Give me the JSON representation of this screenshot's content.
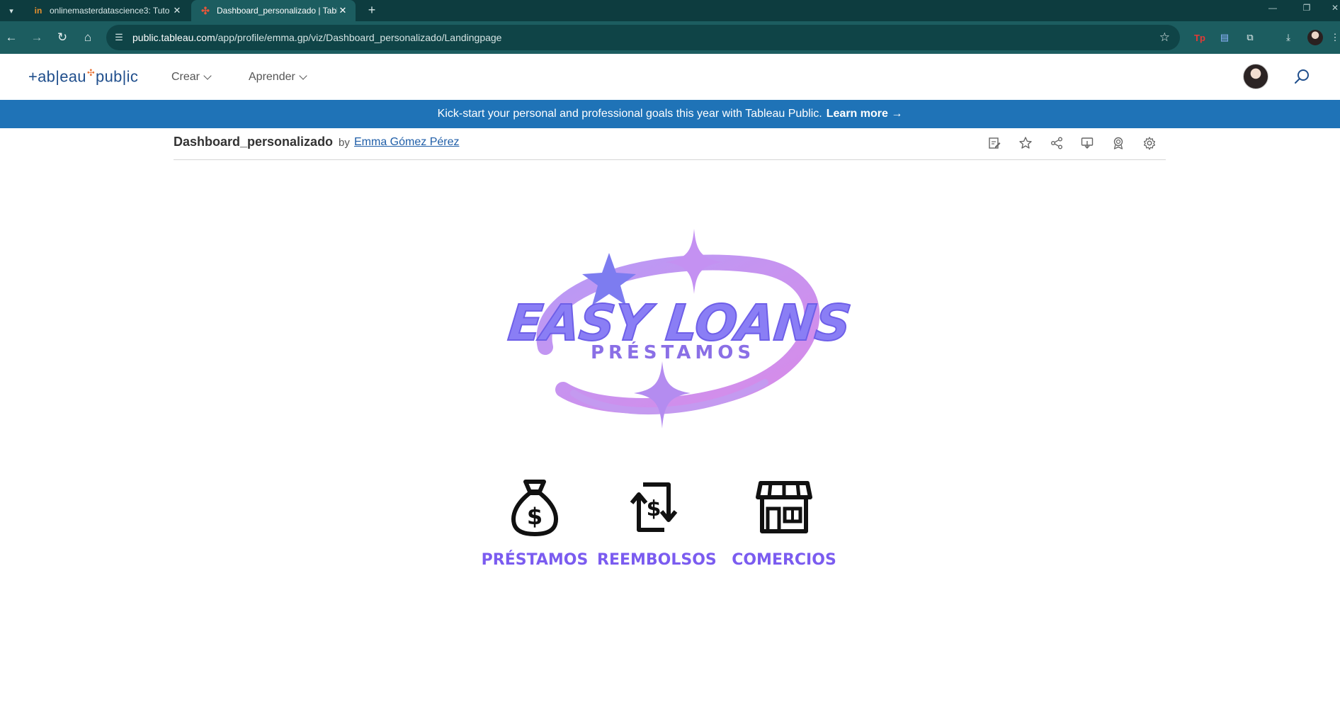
{
  "browser": {
    "tabs": [
      {
        "title": "onlinemasterdatascience3: Tuto",
        "favicon": "in",
        "active": false
      },
      {
        "title": "Dashboard_personalizado | Tabl",
        "favicon": "✣",
        "active": true
      }
    ],
    "url_host": "public.tableau.com",
    "url_path": "/app/profile/emma.gp/viz/Dashboard_personalizado/Landingpage",
    "extensions": [
      "Tp",
      "doc-icon",
      "puzzle-icon"
    ]
  },
  "header": {
    "logo": "+ab|eau+pub|ic",
    "menu": [
      {
        "label": "Crear"
      },
      {
        "label": "Aprender"
      }
    ]
  },
  "banner": {
    "text": "Kick-start your personal and professional goals this year with Tableau Public.",
    "cta": "Learn more →"
  },
  "viz": {
    "title": "Dashboard_personalizado",
    "by": "by",
    "author": "Emma Gómez Pérez",
    "actions": [
      "edit-icon",
      "star-icon",
      "share-icon",
      "download-icon",
      "badge-icon",
      "gear-icon"
    ]
  },
  "dashboard": {
    "logo_title": "EASY LOANS",
    "logo_subtitle": "PRÉSTAMOS",
    "categories": [
      {
        "label": "PRÉSTAMOS",
        "icon": "money-bag-icon"
      },
      {
        "label": "REEMBOLSOS",
        "icon": "refund-icon"
      },
      {
        "label": "COMERCIOS",
        "icon": "store-icon"
      }
    ],
    "colors": {
      "accent": "#7b5cf0",
      "banner": "#1f73b7",
      "chrome": "#1c5d60"
    }
  }
}
